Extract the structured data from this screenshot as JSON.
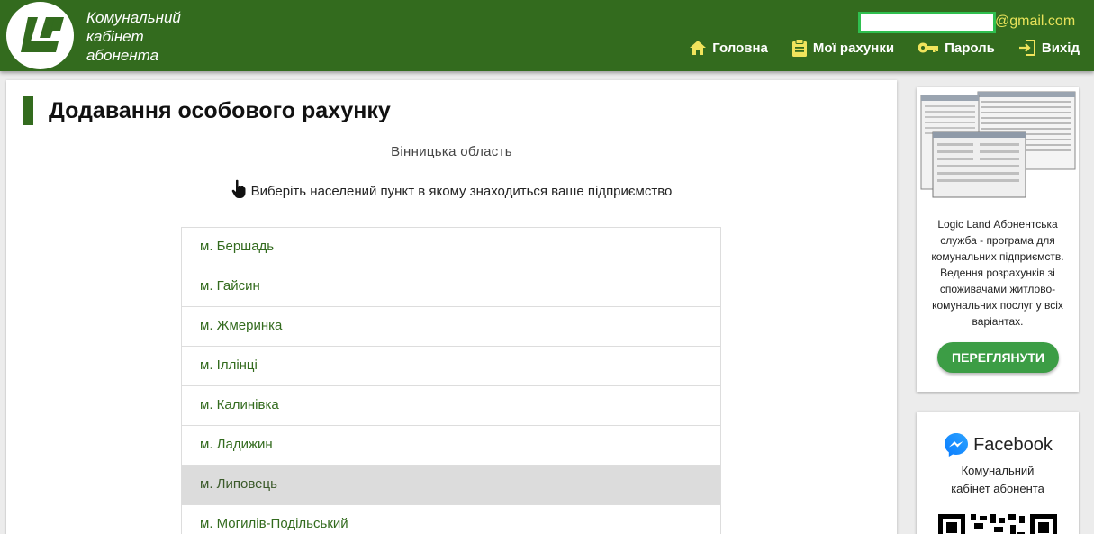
{
  "header": {
    "brand_lines": [
      "Комунальний",
      "кабінет",
      "абонента"
    ],
    "email_suffix": "@gmail.com",
    "nav": [
      {
        "label": "Головна",
        "icon": "home-icon"
      },
      {
        "label": "Мої рахунки",
        "icon": "clipboard-icon"
      },
      {
        "label": "Пароль",
        "icon": "key-icon"
      },
      {
        "label": "Вихід",
        "icon": "logout-icon"
      }
    ]
  },
  "main": {
    "title": "Додавання особового рахунку",
    "region": "Вінницька область",
    "hint": "Виберіть населений пункт в якому знаходиться ваше підприємство",
    "cities": [
      "м. Бершадь",
      "м. Гайсин",
      "м. Жмеринка",
      "м. Іллінці",
      "м. Калинівка",
      "м. Ладижин",
      "м. Липовець",
      "м. Могилів-Подільський"
    ],
    "active_city": "м. Липовець"
  },
  "sidebar": {
    "ad_text": "Logic Land Абонентська служба - програма для комунальних підприємств. Ведення розрахунків зі споживачами житлово-комунальних послуг у всіх варіантах.",
    "ad_button": "ПЕРЕГЛЯНУТИ",
    "fb_title": "Facebook",
    "fb_sub_lines": [
      "Комунальний",
      "кабінет абонента"
    ]
  },
  "colors": {
    "header_bg": "#336b1e",
    "accent_green": "#3c9d45",
    "email_suffix": "#e8e25a",
    "nav_icon": "#f0e45c"
  }
}
